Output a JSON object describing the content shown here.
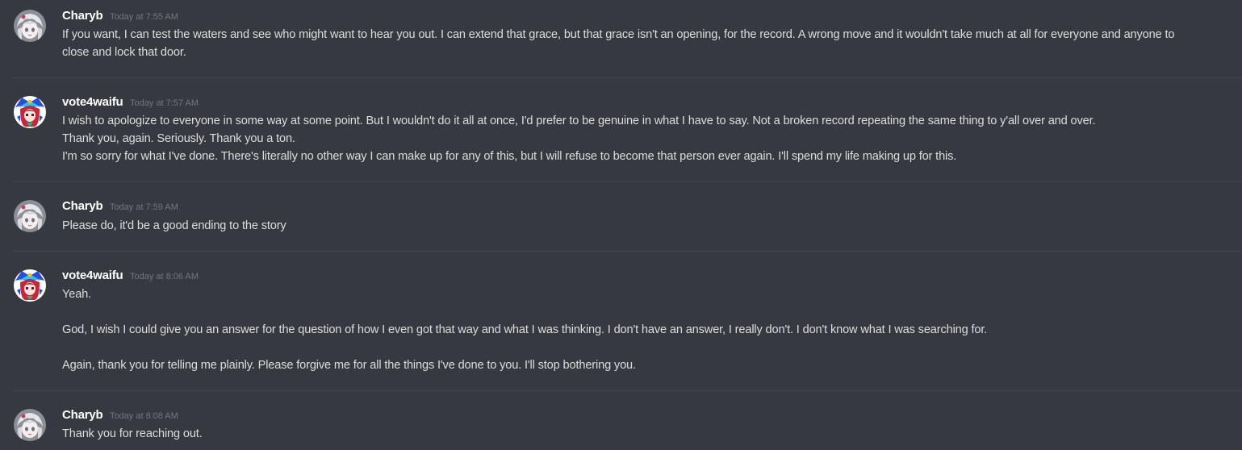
{
  "colors": {
    "background": "#36393f",
    "username": "#ffffff",
    "timestamp": "#72767d",
    "message_text": "#dcddde",
    "divider": "#42454a"
  },
  "messages": [
    {
      "avatar_icon": "charyb-avatar-icon",
      "username": "Charyb",
      "timestamp": "Today at 7:55 AM",
      "lines": [
        "If you want, I can test the waters and see who might want to hear you out. I can extend that grace, but that grace isn't an opening, for the record. A wrong move and it wouldn't take much at all for everyone and anyone to",
        "close and lock that door."
      ]
    },
    {
      "avatar_icon": "vote4waifu-avatar-icon",
      "username": "vote4waifu",
      "timestamp": "Today at 7:57 AM",
      "lines": [
        "I wish to apologize to everyone in some way at some point. But I wouldn't do it all at once, I'd prefer to be genuine in what I have to say. Not a broken record repeating the same thing to y'all over and over.",
        "Thank you, again. Seriously. Thank you a ton.",
        "I'm so sorry for what I've done. There's literally no other way I can make up for any of this, but I will refuse to become that person ever again. I'll spend my life making up for this."
      ]
    },
    {
      "avatar_icon": "charyb-avatar-icon",
      "username": "Charyb",
      "timestamp": "Today at 7:59 AM",
      "lines": [
        "Please do, it'd be a good ending to the story"
      ]
    },
    {
      "avatar_icon": "vote4waifu-avatar-icon",
      "username": "vote4waifu",
      "timestamp": "Today at 8:06 AM",
      "lines": [
        "Yeah.",
        "",
        "God, I wish I could give you an answer for the question of how I even got that way and what I was thinking. I don't have an answer, I really don't. I don't know what I was searching for.",
        "",
        "Again, thank you for telling me plainly. Please forgive me for all the things I've done to you. I'll stop bothering you."
      ]
    },
    {
      "avatar_icon": "charyb-avatar-icon",
      "username": "Charyb",
      "timestamp": "Today at 8:08 AM",
      "lines": [
        "Thank you for reaching out."
      ]
    }
  ]
}
